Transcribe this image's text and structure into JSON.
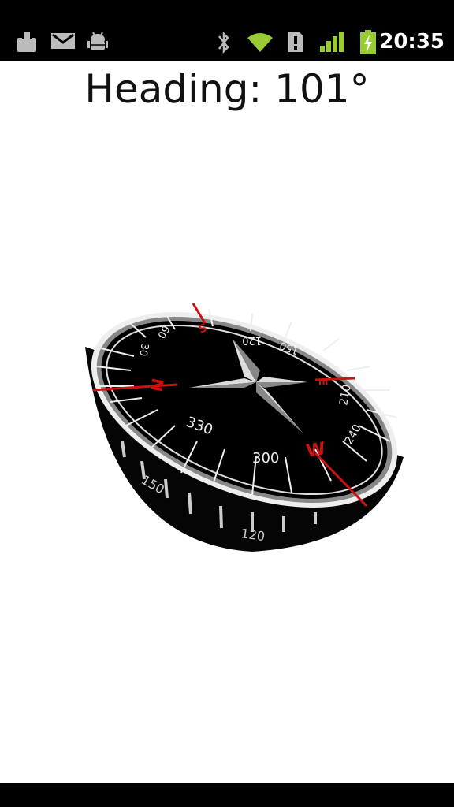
{
  "status_bar": {
    "time": "20:35",
    "left_icons": [
      "download-icon",
      "gmail-icon",
      "android-debug-icon"
    ],
    "right_icons": [
      "bluetooth-icon",
      "wifi-icon",
      "sim-icon",
      "signal-icon",
      "battery-charging-icon"
    ],
    "accent_color": "#99cc33"
  },
  "heading": {
    "text": "Heading: 101°"
  },
  "compass": {
    "degree_labels": [
      "30",
      "60",
      "120",
      "150",
      "210",
      "240",
      "300",
      "330"
    ],
    "cardinal_labels": [
      "N",
      "W",
      "S",
      "E"
    ],
    "rim_labels": [
      "150",
      "120"
    ],
    "cardinal_color": "#cc1111",
    "face_color": "#000000"
  }
}
